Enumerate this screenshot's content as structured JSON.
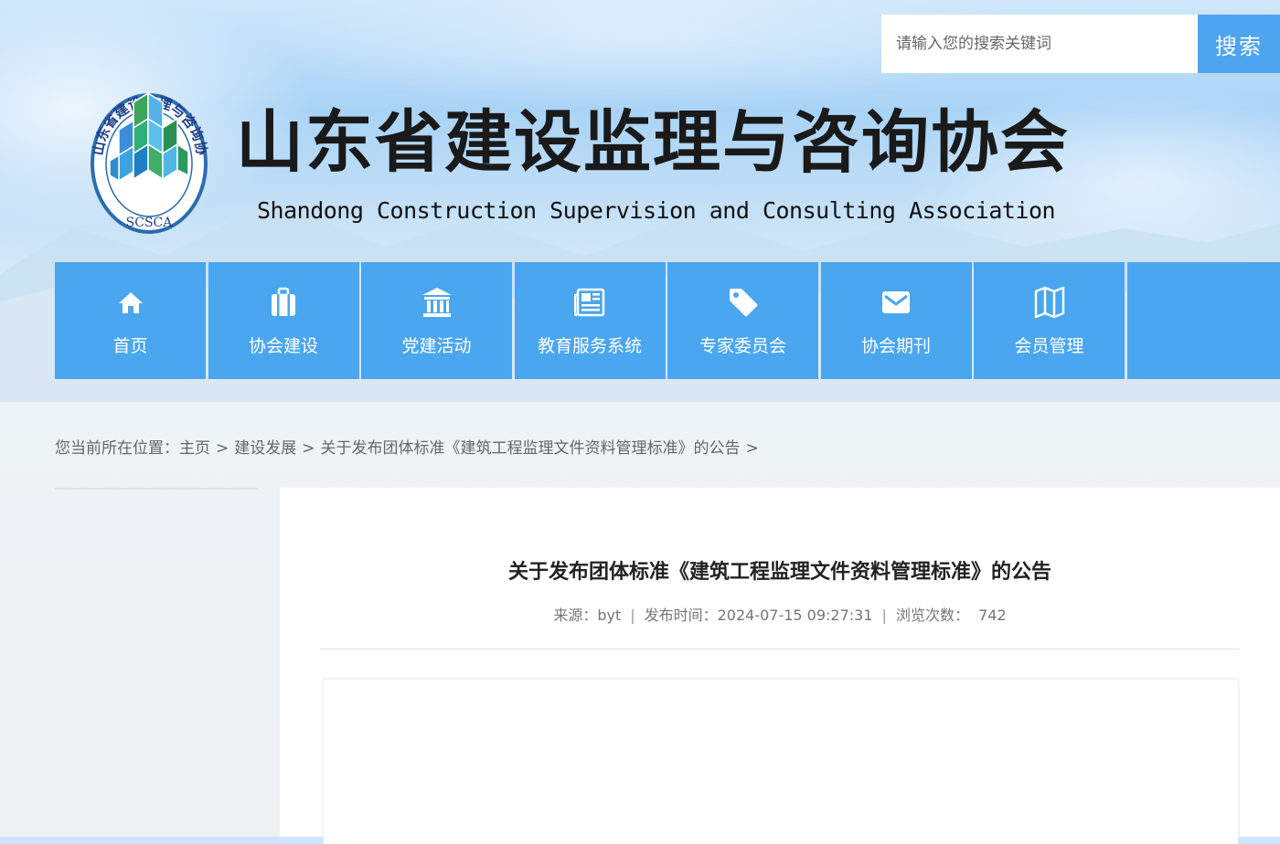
{
  "search": {
    "placeholder": "请输入您的搜索关键词",
    "button_label": "搜索"
  },
  "header": {
    "logo_text": "山东省建设监理与咨询协会",
    "logo_abbr": "SCSCA",
    "title_cn": "山东省建设监理与咨询协会",
    "title_en": "Shandong Construction Supervision and Consulting Association"
  },
  "nav": {
    "items": [
      {
        "label": "首页",
        "icon": "home-icon"
      },
      {
        "label": "协会建设",
        "icon": "briefcase-icon"
      },
      {
        "label": "党建活动",
        "icon": "bank-icon"
      },
      {
        "label": "教育服务系统",
        "icon": "newspaper-icon"
      },
      {
        "label": "专家委员会",
        "icon": "tag-icon"
      },
      {
        "label": "协会期刊",
        "icon": "envelope-icon"
      },
      {
        "label": "会员管理",
        "icon": "map-icon"
      }
    ]
  },
  "breadcrumb": {
    "prefix": "您当前所在位置：",
    "items": [
      "主页",
      "建设发展",
      "关于发布团体标准《建筑工程监理文件资料管理标准》的公告"
    ],
    "separator": ">"
  },
  "article": {
    "title": "关于发布团体标准《建筑工程监理文件资料管理标准》的公告",
    "source_label": "来源：byt",
    "time_label": "发布时间：2024-07-15 09:27:31",
    "views_label": "浏览次数：",
    "views": "742"
  },
  "colors": {
    "nav_bg": "#4aa6ee",
    "search_button": "#4ea4ee"
  }
}
